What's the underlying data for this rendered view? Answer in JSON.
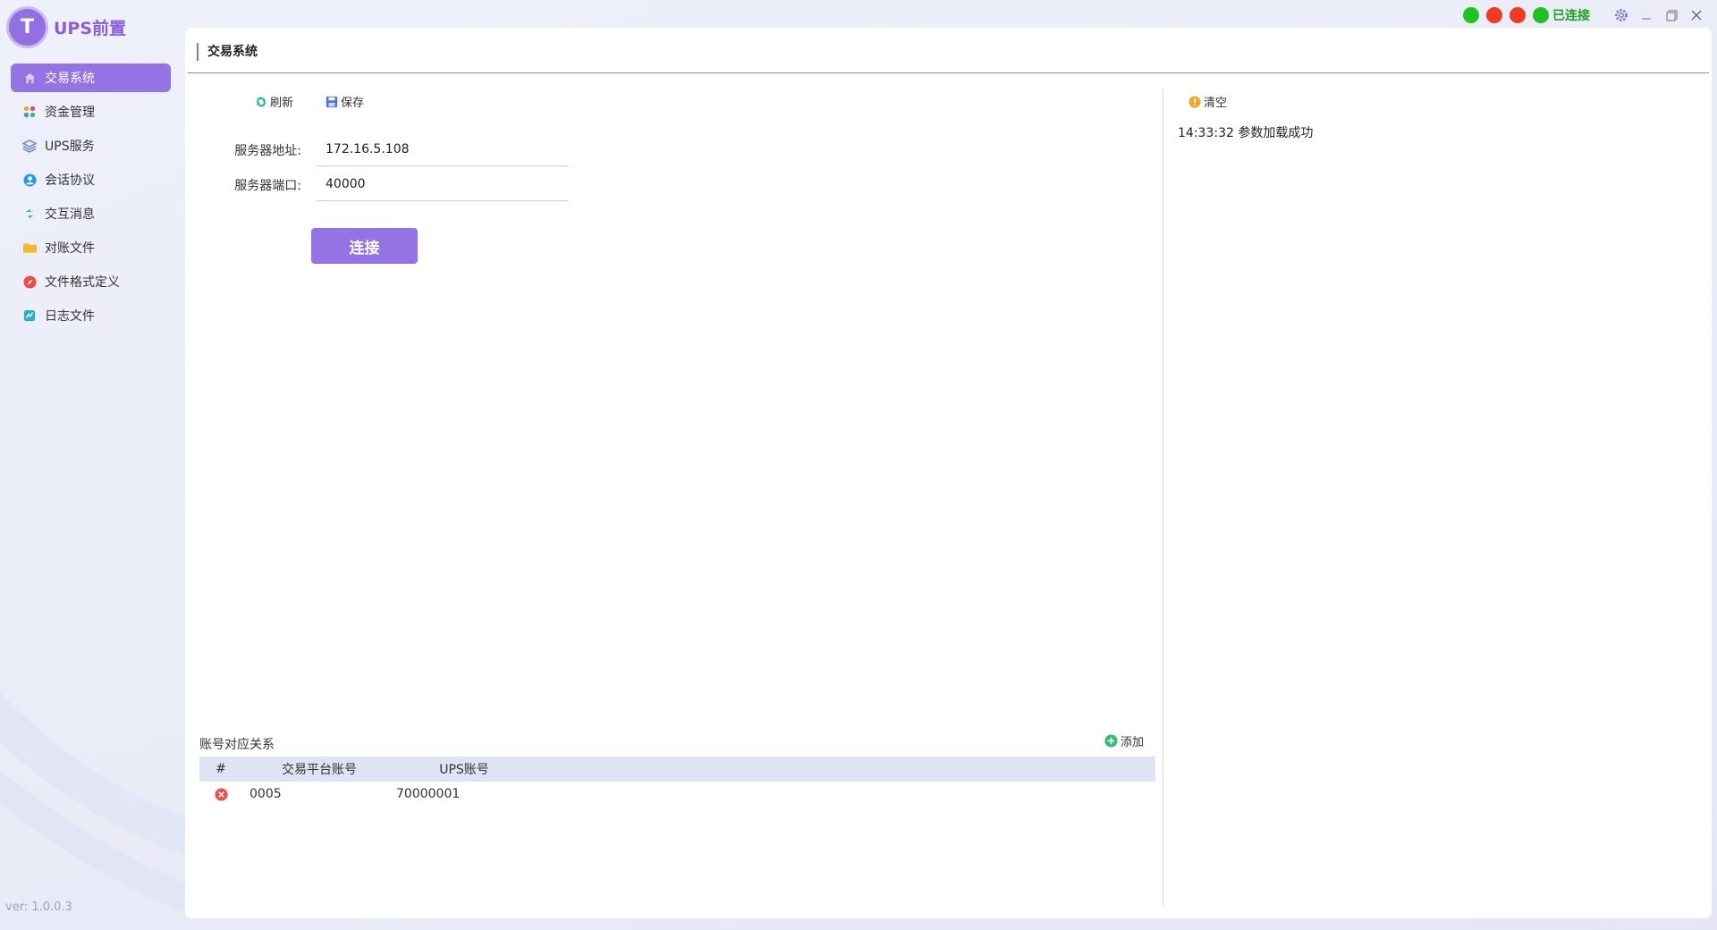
{
  "app": {
    "logo_letter": "T",
    "title": "UPS前置",
    "version": "ver: 1.0.0.3"
  },
  "colors": {
    "accent": "#9474e4",
    "connected": "#1aa51a",
    "dot_green": "#1ec41e",
    "dot_red": "#f23a1f"
  },
  "status": {
    "text": "已连接",
    "dots": [
      "green",
      "red",
      "red",
      "green"
    ]
  },
  "sidebar": {
    "items": [
      {
        "label": "交易系统",
        "icon": "home-icon",
        "active": true
      },
      {
        "label": "资金管理",
        "icon": "apps-icon"
      },
      {
        "label": "UPS服务",
        "icon": "layers-icon"
      },
      {
        "label": "会话协议",
        "icon": "user-icon"
      },
      {
        "label": "交互消息",
        "icon": "exchange-icon"
      },
      {
        "label": "对账文件",
        "icon": "folder-icon"
      },
      {
        "label": "文件格式定义",
        "icon": "compass-icon"
      },
      {
        "label": "日志文件",
        "icon": "log-icon"
      }
    ]
  },
  "page": {
    "title": "交易系统"
  },
  "toolbar": {
    "refresh_label": "刷新",
    "save_label": "保存"
  },
  "form": {
    "server_address_label": "服务器地址:",
    "server_address_value": "172.16.5.108",
    "server_port_label": "服务器端口:",
    "server_port_value": "40000",
    "connect_label": "连接"
  },
  "accounts": {
    "title": "账号对应关系",
    "add_label": "添加",
    "columns": [
      "#",
      "交易平台账号",
      "UPS账号"
    ],
    "rows": [
      {
        "trade_account": "0005",
        "ups_account": "70000001"
      }
    ]
  },
  "log": {
    "clear_label": "清空",
    "lines": [
      "14:33:32 参数加载成功"
    ]
  }
}
